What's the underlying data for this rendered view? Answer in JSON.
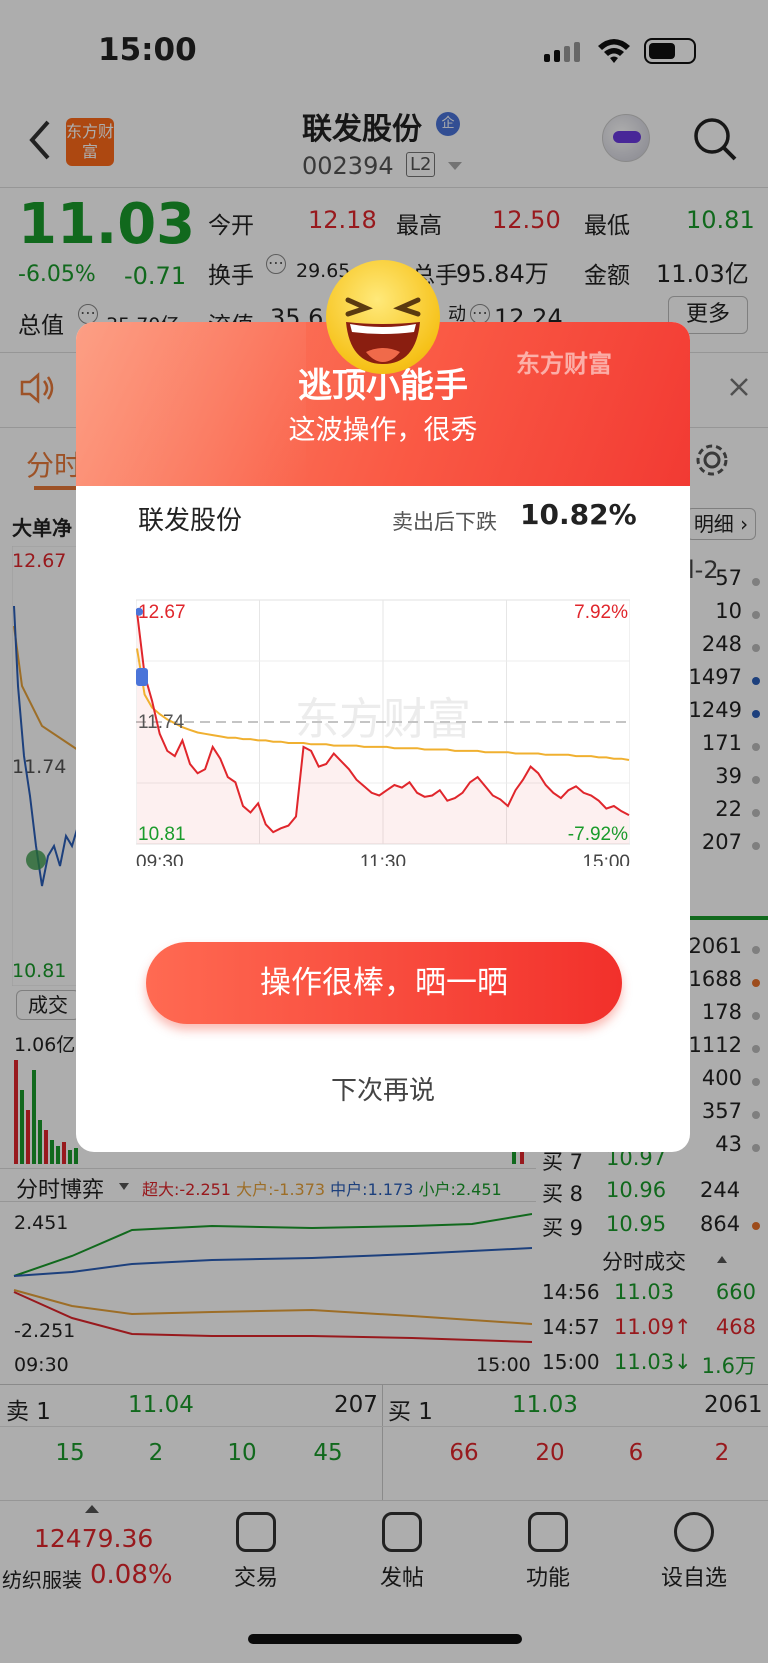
{
  "status": {
    "time": "15:00"
  },
  "header": {
    "logo_text": "东方财富",
    "title": "联发股份",
    "badge": "企",
    "code": "002394",
    "level": "L2"
  },
  "quote": {
    "price": "11.03",
    "pct": "-6.05%",
    "chg": "-0.71",
    "open_label": "今开",
    "open": "12.18",
    "high_label": "最高",
    "high": "12.50",
    "low_label": "最低",
    "low": "10.81",
    "turnover_label": "换手",
    "turnover": "29.65",
    "vol_label": "总手",
    "vol": "95.84万",
    "amount_label": "金额",
    "amount": "11.03亿",
    "mktcap_label": "总值",
    "mktcap": "35.70亿",
    "float_label": "流值",
    "float": "35.6",
    "ratio_label": "动",
    "ratio": "12.24",
    "more": "更多"
  },
  "tabs": {
    "first": "分时"
  },
  "left_chart": {
    "section_label": "大单净",
    "top": "12.67",
    "mid": "11.74",
    "bottom": "10.81",
    "vol_label": "成交",
    "vol_max": "1.06亿"
  },
  "right_panel": {
    "detail_btn": "明细 ›",
    "l2": "l-2",
    "sells": [
      "57",
      "10",
      "248",
      "1497",
      "1249",
      "171",
      "39",
      "22",
      "207"
    ],
    "buys": [
      "2061",
      "1688",
      "178",
      "1112",
      "400",
      "357",
      "43"
    ],
    "buy8_label": "买 8",
    "buy8_price": "10.96",
    "buy8_vol": "244",
    "buy9_label": "买 9",
    "buy9_price": "10.95",
    "buy9_vol": "864",
    "buy7_label": "买 7",
    "buy7_price": "10.97"
  },
  "game": {
    "title": "分时博弈",
    "super_label": "超大:",
    "super": "-2.251",
    "big_label": "大户:",
    "big": "-1.373",
    "mid_label": "中户:",
    "mid": "1.173",
    "small_label": "小户:",
    "small": "2.451",
    "top": "2.451",
    "bottom": "-2.251",
    "t_start": "09:30",
    "t_end": "15:00"
  },
  "ticks": {
    "title": "分时成交",
    "rows": [
      {
        "time": "14:56",
        "price": "11.03",
        "arrow": "",
        "vol": "660"
      },
      {
        "time": "14:57",
        "price": "11.09",
        "arrow": "↑",
        "vol": "468"
      },
      {
        "time": "15:00",
        "price": "11.03",
        "arrow": "↓",
        "vol": "1.6万"
      }
    ]
  },
  "book": {
    "sell1_label": "卖 1",
    "sell1_price": "11.04",
    "sell1_vol": "207",
    "buy1_label": "买 1",
    "buy1_price": "11.03",
    "buy1_vol": "2061",
    "sell_q": [
      "15",
      "2",
      "10",
      "45"
    ],
    "buy_q": [
      "66",
      "20",
      "6",
      "2"
    ]
  },
  "bottom": {
    "index_value": "12479.36",
    "index_name": "纺织服装",
    "index_pct": "0.08%",
    "tabs": [
      "交易",
      "发帖",
      "功能",
      "设自选"
    ]
  },
  "modal": {
    "watermark": "东方财富",
    "title": "逃顶小能手",
    "subtitle": "这波操作，很秀",
    "stock": "联发股份",
    "drop_label": "卖出后下跌",
    "drop_value": "10.82%",
    "share_btn": "操作很棒，晒一晒",
    "later": "下次再说"
  },
  "chart_data": {
    "type": "line",
    "x_start": "09:30",
    "x_mid": "11:30",
    "x_end": "15:00",
    "ylim": [
      10.81,
      12.67
    ],
    "y_top_label": "12.67",
    "y_mid_label": "11.74",
    "y_bottom_label": "10.81",
    "pct_top": "7.92%",
    "pct_bottom": "-7.92%",
    "watermark": "东方财富",
    "series": [
      {
        "values": [
          12.58,
          12.1,
          11.9,
          11.65,
          11.52,
          11.48,
          11.6,
          11.42,
          11.35,
          11.38,
          11.55,
          11.46,
          11.32,
          11.28,
          11.1,
          11.05,
          11.12,
          10.96,
          10.9,
          10.93,
          10.95,
          11.02,
          11.55,
          11.52,
          11.4,
          11.42,
          11.5,
          11.44,
          11.38,
          11.3,
          11.25,
          11.2,
          11.18,
          11.22,
          11.26,
          11.24,
          11.28,
          11.2,
          11.17,
          11.18,
          11.22,
          11.14,
          11.16,
          11.2,
          11.28,
          11.32,
          11.25,
          11.18,
          11.15,
          11.1,
          11.22,
          11.3,
          11.4,
          11.35,
          11.26,
          11.2,
          11.16,
          11.22,
          11.25,
          11.2,
          11.18,
          11.14,
          11.08,
          11.1,
          11.06,
          11.03
        ]
      },
      {
        "values": [
          12.3,
          11.95,
          11.85,
          11.8,
          11.76,
          11.73,
          11.7,
          11.68,
          11.66,
          11.65,
          11.64,
          11.63,
          11.62,
          11.62,
          11.61,
          11.61,
          11.6,
          11.6,
          11.59,
          11.59,
          11.58,
          11.58,
          11.58,
          11.57,
          11.57,
          11.57,
          11.56,
          11.56,
          11.56,
          11.56,
          11.55,
          11.55,
          11.55,
          11.55,
          11.54,
          11.54,
          11.54,
          11.54,
          11.53,
          11.53,
          11.53,
          11.53,
          11.52,
          11.52,
          11.52,
          11.52,
          11.51,
          11.51,
          11.51,
          11.51,
          11.5,
          11.5,
          11.5,
          11.5,
          11.49,
          11.49,
          11.49,
          11.49,
          11.48,
          11.48,
          11.48,
          11.47,
          11.47,
          11.46,
          11.46,
          11.45
        ]
      }
    ]
  }
}
